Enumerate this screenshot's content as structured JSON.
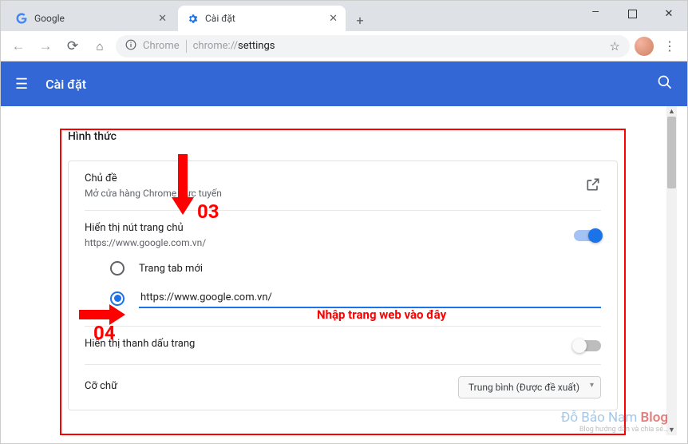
{
  "window": {
    "tabs": [
      {
        "title": "Google",
        "icon": "google"
      },
      {
        "title": "Cài đặt",
        "icon": "gear"
      }
    ]
  },
  "addressBar": {
    "host": "Chrome",
    "path": "chrome://settings",
    "pathDisplay": "settings"
  },
  "header": {
    "title": "Cài đặt"
  },
  "section": {
    "title": "Hình thức",
    "theme": {
      "title": "Chủ đề",
      "subtitle": "Mở cửa hàng Chrome trực tuyến"
    },
    "homebutton": {
      "title": "Hiển thị nút trang chủ",
      "subtitle": "https://www.google.com.vn/",
      "enabled": true
    },
    "homeoptions": {
      "newtab": "Trang tab mới",
      "custom_value": "https://www.google.com.vn/"
    },
    "bookmarksbar": {
      "title": "Hiển thị thanh dấu trang",
      "enabled": false
    },
    "fontsize": {
      "title": "Cỡ chữ",
      "value": "Trung bình (Được đề xuất)"
    }
  },
  "annotations": {
    "num03": "03",
    "num04": "04",
    "input_hint": "Nhập trang web vào đây"
  },
  "watermark": {
    "line1a": "Đỗ Bảo Nam ",
    "line1b": "Blog",
    "line2": "Blog hướng dẫn và chia sẻ…"
  }
}
